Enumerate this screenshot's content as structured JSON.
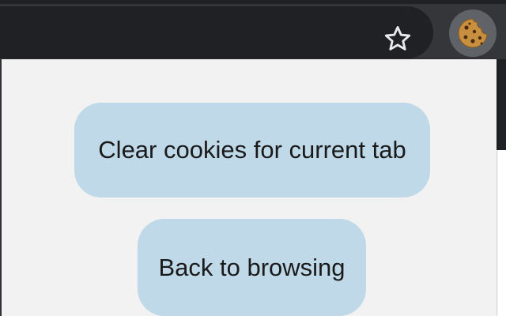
{
  "toolbar": {
    "bookmark_icon": "star-outline-icon",
    "extension_icon": "cookie-icon"
  },
  "popup": {
    "clear_button_label": "Clear cookies for current tab",
    "back_button_label": "Back to browsing"
  },
  "colors": {
    "toolbar_bg": "#35363a",
    "omnibox_bg": "#202124",
    "popup_bg": "#f2f2f2",
    "button_bg": "#bfd9e8",
    "button_text": "#1a1a1a"
  }
}
